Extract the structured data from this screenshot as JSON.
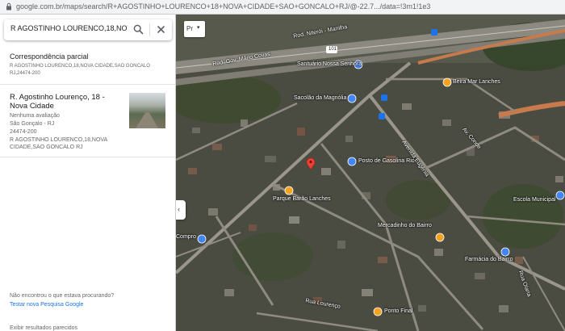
{
  "browser": {
    "url": "google.com.br/maps/search/R+AGOSTINHO+LOURENCO+18+NOVA+CIDADE+SAO+GONCALO+RJ/@-22.7.../data=!3m1!1e3"
  },
  "search": {
    "value": "R AGOSTINHO LOURENCO,18,NOVA C"
  },
  "partial": {
    "title": "Correspondência parcial",
    "subtitle": "R AGOSTINHO LOURENCO,18,NOVA CIDADE,SAO GONCALO RJ,24474-200"
  },
  "result": {
    "title": "R. Agostinho Lourenço, 18 - Nova Cidade",
    "rating": "Nenhuma avaliação",
    "city": "São Gonçalo - RJ",
    "cep": "24474-200",
    "raw_line1": "R AGOSTINHO LOURENCO,18,NOVA",
    "raw_line2": "CIDADE,SAO GONCALO RJ"
  },
  "footer": {
    "missing": "Não encontrou o que estava procurando?",
    "test_link": "Testar nova Pesquisa Google",
    "bottom": "Exibir resultados parecidos"
  },
  "map_controls": {
    "layer_label": "Pr"
  },
  "map_labels": {
    "road1": "Rod. Niterói - Manilha",
    "road2": "Rod. Gov. Mário Covas",
    "route": "101",
    "place1": "Santuário Nossa Senhora",
    "place2": "Sacolão da Magnólia",
    "place3": "Beira Mar Lanches",
    "place4": "Posto de Gasolina Rio",
    "place5": "Parque Barão Lanches",
    "place6": "Mercadinho do Bairro",
    "place7": "Farmácia do Bairro",
    "place8": "Escola Municipal",
    "place9": "Ponto Final",
    "place10": "Compro",
    "street1": "Avenida Eugênia",
    "street2": "Av. Conde",
    "street3": "Rua Lourenço",
    "street4": "Rua Olaria"
  },
  "colors": {
    "accent": "#1a73e8",
    "pin_red": "#ea4335",
    "pin_orange": "#f4a223",
    "pin_blue": "#4285f4"
  }
}
